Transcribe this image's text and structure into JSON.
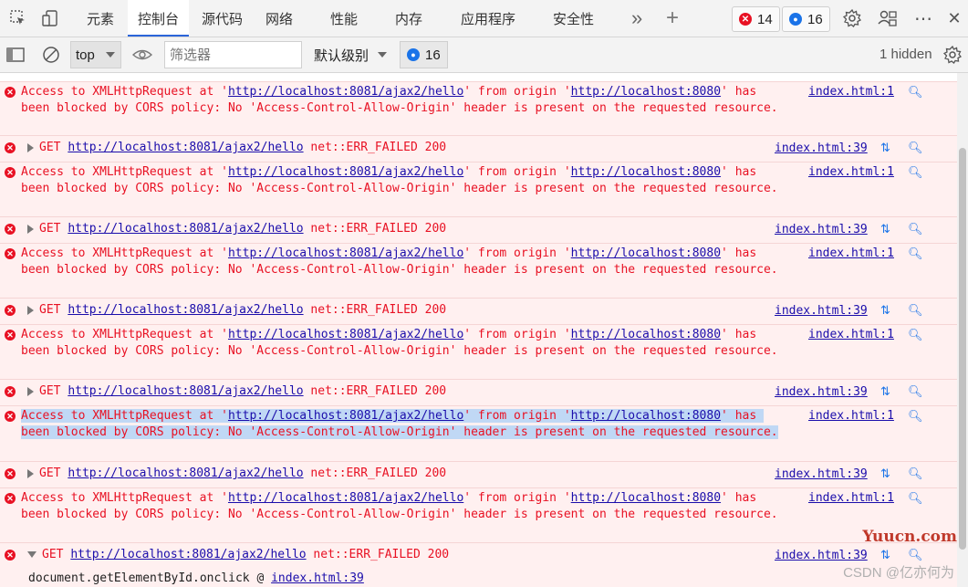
{
  "tabs": {
    "elements": "元素",
    "console": "控制台",
    "sources": "源代码",
    "network": "网络",
    "performance": "性能",
    "memory": "内存",
    "application": "应用程序",
    "security": "安全性",
    "more": "»",
    "add": "+"
  },
  "badges": {
    "errors": "14",
    "messages": "16"
  },
  "toolbar": {
    "context": "top",
    "filter_placeholder": "筛选器",
    "level": "默认级别",
    "messages_count": "16",
    "hidden": "1 hidden"
  },
  "console": {
    "cors_prefix": "Access to XMLHttpRequest at '",
    "cors_url": "http://localhost:8081/ajax2/hello",
    "cors_mid": "' from origin '",
    "cors_origin": "http://localhost:8080",
    "cors_suffix": "' has been blocked by CORS policy: No 'Access-Control-Allow-Origin' header is present on the requested resource.",
    "get_method": "GET",
    "get_url": "http://localhost:8081/ajax2/hello",
    "get_status": "net::ERR_FAILED 200",
    "src_cors": "index.html:1",
    "src_get": "index.html:39",
    "stack_fn": "document.getElementById.onclick @",
    "stack_src": "index.html:39"
  },
  "watermark": {
    "site": "Yuucn.com",
    "csdn": "CSDN @亿亦何为"
  },
  "colors": {
    "error": "#e81123",
    "error_bg": "#fff0f0",
    "link": "#1a0dab",
    "accent": "#1a73e8",
    "selection": "#c0d8f5"
  }
}
